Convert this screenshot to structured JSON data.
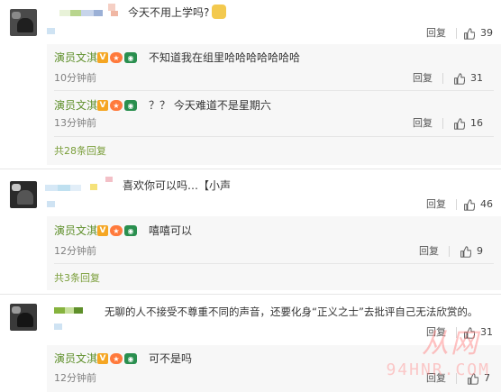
{
  "reply_label": "回复",
  "main_comments": [
    {
      "text": "今天不用上学吗?",
      "likes": "39"
    },
    {
      "text": "喜欢你可以吗…【小声",
      "likes": "46"
    },
    {
      "text": "无聊的人不接受不尊重不同的声音，还要化身“正义之士”去批评自己无法欣赏的。",
      "likes": "31"
    }
  ],
  "sub_replies": [
    {
      "name": "演员文淇",
      "text": "不知道我在组里哈哈哈哈哈哈哈",
      "time": "10分钟前",
      "likes": "31"
    },
    {
      "name": "演员文淇",
      "text": "？？ 今天难道不是星期六",
      "time": "13分钟前",
      "likes": "16"
    },
    {
      "name": "演员文淇",
      "text": "嘻嘻可以",
      "time": "12分钟前",
      "likes": "9"
    },
    {
      "name": "演员文淇",
      "text": "可不是吗",
      "time": "12分钟前",
      "likes": "7"
    }
  ],
  "more_links": [
    "共28条回复",
    "共3条回复"
  ],
  "watermark": {
    "main": "从网",
    "sub": "94HNR.COM"
  },
  "colors": {
    "name_green": "#5e8f2a",
    "link_green": "#7a9e3a",
    "reply_bg": "#f7f7f7"
  }
}
